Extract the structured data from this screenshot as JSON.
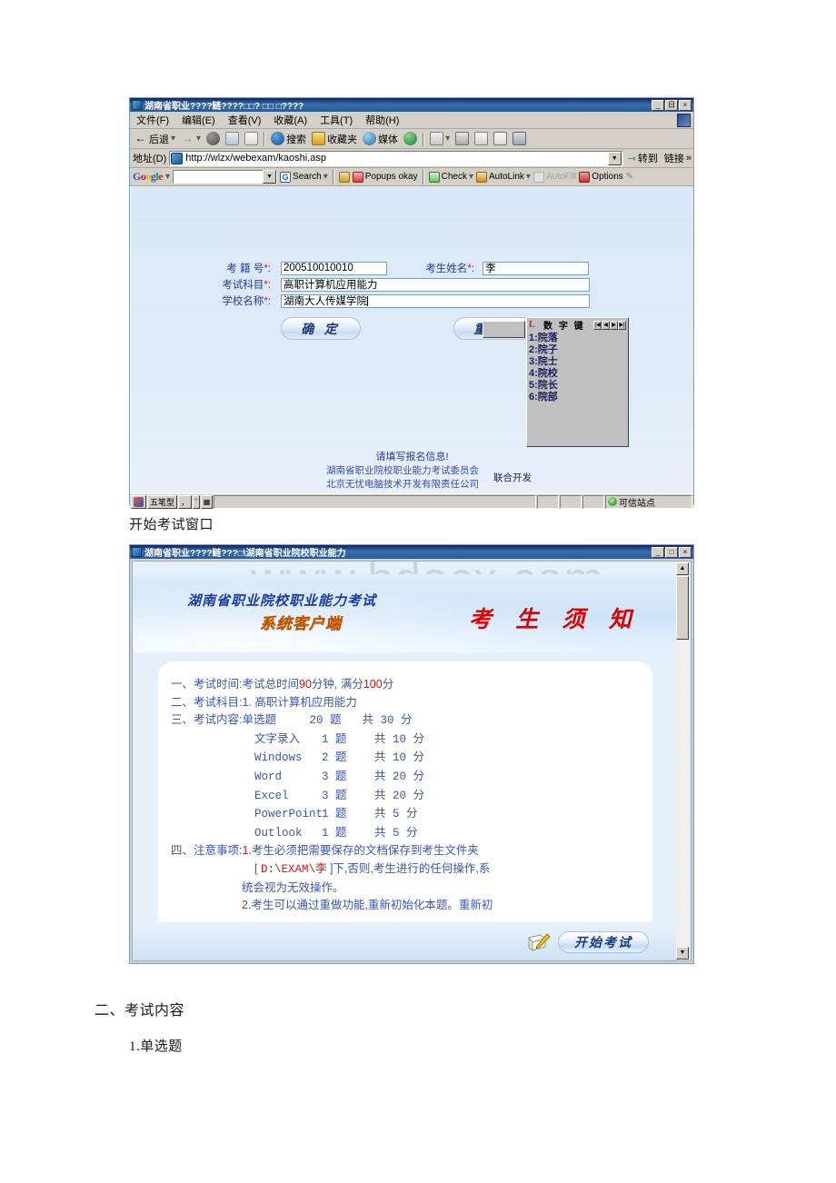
{
  "document": {
    "caption1": "开始考试窗口",
    "heading2": "二、考试内容",
    "sub1": "1.单选题"
  },
  "browser_window": {
    "title": "湖南省职业????鲢????□□?  □□   □????",
    "window_buttons": {
      "minimize": "_",
      "maximize": "日",
      "close": "×"
    },
    "menu": [
      {
        "label": "文件(F)"
      },
      {
        "label": "编辑(E)"
      },
      {
        "label": "查看(V)"
      },
      {
        "label": "收藏(A)"
      },
      {
        "label": "工具(T)"
      },
      {
        "label": "帮助(H)"
      }
    ],
    "toolbar": {
      "back": "后退",
      "forward": "→",
      "stop_icon": "stop-icon",
      "refresh_icon": "refresh-icon",
      "home_icon": "home-icon",
      "search": "搜索",
      "favorites": "收藏夹",
      "media": "媒体",
      "history_icon": "history-icon",
      "mail_icon": "mail-icon",
      "print_icon": "print-icon",
      "edit_icon": "edit-icon",
      "discuss_icon": "discuss-icon",
      "messenger_icon": "messenger-icon"
    },
    "address": {
      "label": "地址(D)",
      "url": "http://wlzx/webexam/kaoshi.asp",
      "go": "转到",
      "links": "链接"
    },
    "google_toolbar": {
      "brand": "Google",
      "search_value": "",
      "search_button": "Search",
      "popups": "Popups okay",
      "check": "Check",
      "autolink": "AutoLink",
      "autofill": "AutoFill",
      "options": "Options"
    },
    "form": {
      "fields": [
        {
          "label": "考 籍 号",
          "star": "*",
          "value": "200510010010"
        },
        {
          "label": "考生姓名",
          "star": "*",
          "value": "李"
        },
        {
          "label": "考试科目",
          "star": "*",
          "value": "高职计算机应用能力"
        },
        {
          "label": "学校名称",
          "star": "*",
          "value": "湖南大人传媒学院"
        }
      ],
      "submit_label": "确  定",
      "reset_label": "重  置"
    },
    "ime": {
      "logo": "L",
      "title": "数 字 键",
      "nav": [
        "|◀",
        "◀",
        "▶",
        "▶|"
      ],
      "candidates": [
        "1:院落",
        "2:院子",
        "3:院士",
        "4:院校",
        "5:院长",
        "6:院部"
      ]
    },
    "tip": "请填写报名信息!",
    "footer": {
      "line1": "湖南省职业院校职业能力考试委员会",
      "line2": "北京无忧电脑技术开发有限责任公司",
      "right": "联合开发"
    },
    "statusbar": {
      "ime_mode": "五笔型",
      "ime_punct": "，",
      "ime_half": "'",
      "ime_keyboard": "keyboard-icon",
      "zone_icon": "trusted-site-icon",
      "zone": "可信站点"
    }
  },
  "exam_window": {
    "title": "湖南省职业????鲢???□\\湖南省职业院校职业能力",
    "window_buttons": {
      "minimize": "_",
      "maximize": "□",
      "close": "×"
    },
    "watermark": "www.bdocx.com",
    "banner": {
      "line1": "湖南省职业院校职业能力考试",
      "line2": "系统客户端",
      "title": "考 生 须 知"
    },
    "rules": {
      "r1_label": "一、考试时间:",
      "r1_a": "考试总时间",
      "r1_minutes": "90",
      "r1_b": "分钟, 满分",
      "r1_score": "100",
      "r1_c": "分",
      "r2_label": "二、考试科目:",
      "r2_text": "1. 高职计算机应用能力",
      "r3_label": "三、考试内容:",
      "items": [
        {
          "name": "单选题",
          "count": "20 题",
          "score": "共 30 分"
        },
        {
          "name": "文字录入",
          "count": "1 题",
          "score": "共 10 分"
        },
        {
          "name": "Windows",
          "count": "2 题",
          "score": "共 10 分"
        },
        {
          "name": "Word",
          "count": "3 题",
          "score": "共 20 分"
        },
        {
          "name": "Excel",
          "count": "3 题",
          "score": "共 20 分"
        },
        {
          "name": "PowerPoint",
          "count": "1 题",
          "score": "共 5 分"
        },
        {
          "name": "Outlook",
          "count": "1 题",
          "score": "共 5 分"
        }
      ],
      "r4_label": "四、注意事项:",
      "r4_num1": "1.",
      "r4_1a": "考生必须把需要保存的文档保存到考生文件夹",
      "r4_1b_open": "[ ",
      "r4_1b_path": "D:\\EXAM\\李",
      "r4_1b_close": " ]下,否则,考生进行的任何操作,系",
      "r4_1c": "统会视为无效操作。",
      "r4_num2": "2.",
      "r4_2a": "考生可以通过重做功能,重新初始化本题。重新初"
    },
    "bottom": {
      "pencil_icon": "pencil-icon",
      "start_label": "开始考试"
    },
    "scrollbar": {
      "up": "▲",
      "down": "▼"
    }
  },
  "colors": {
    "accent_blue": "#3a55c0",
    "red": "#e01010",
    "title_blue": "#0a246a",
    "banner_orange": "#f0a000"
  }
}
